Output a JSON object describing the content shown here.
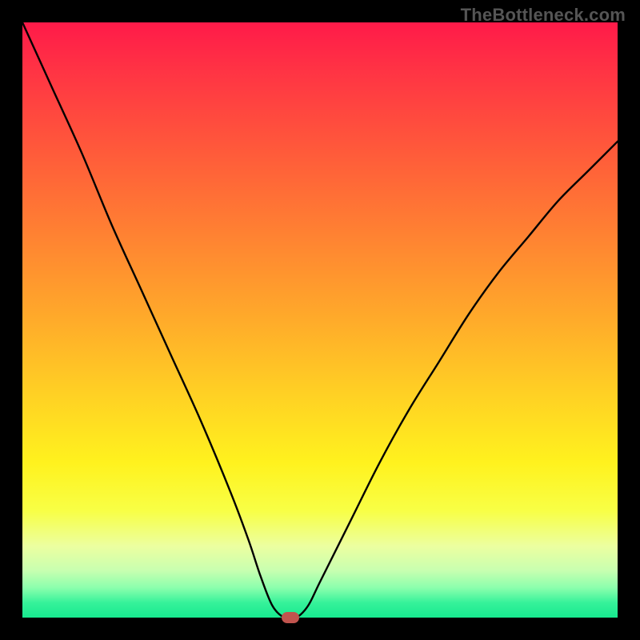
{
  "watermark": "TheBottleneck.com",
  "colors": {
    "frame": "#000000",
    "curve": "#000000",
    "marker": "#c1544e",
    "gradient_top": "#ff1a49",
    "gradient_bottom": "#17e98f"
  },
  "chart_data": {
    "type": "line",
    "title": "",
    "xlabel": "",
    "ylabel": "",
    "xlim": [
      0,
      100
    ],
    "ylim": [
      0,
      100
    ],
    "grid": false,
    "legend": false,
    "annotations": [],
    "x": [
      0,
      5,
      10,
      15,
      20,
      25,
      30,
      35,
      38,
      40,
      42,
      44,
      46,
      48,
      50,
      55,
      60,
      65,
      70,
      75,
      80,
      85,
      90,
      95,
      100
    ],
    "values": [
      100,
      89,
      78,
      66,
      55,
      44,
      33,
      21,
      13,
      7,
      2,
      0,
      0,
      2,
      6,
      16,
      26,
      35,
      43,
      51,
      58,
      64,
      70,
      75,
      80
    ],
    "marker": {
      "x": 45,
      "y": 0
    }
  }
}
